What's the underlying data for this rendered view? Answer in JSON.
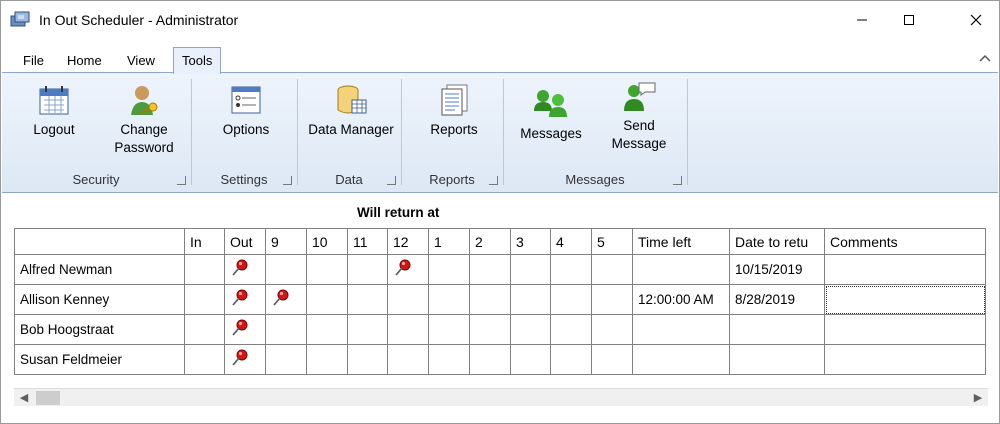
{
  "window": {
    "title": "In Out Scheduler - Administrator"
  },
  "tabs": [
    {
      "label": "File"
    },
    {
      "label": "Home"
    },
    {
      "label": "View"
    },
    {
      "label": "Tools"
    }
  ],
  "active_tab": "Tools",
  "ribbon": {
    "groups": [
      {
        "label": "Security",
        "buttons": [
          {
            "label": "Logout",
            "icon": "calendar-icon"
          },
          {
            "label1": "Change",
            "label2": "Password",
            "icon": "user-key-icon"
          }
        ]
      },
      {
        "label": "Settings",
        "buttons": [
          {
            "label": "Options",
            "icon": "options-form-icon"
          }
        ]
      },
      {
        "label": "Data",
        "buttons": [
          {
            "label": "Data Manager",
            "icon": "database-icon"
          }
        ]
      },
      {
        "label": "Reports",
        "buttons": [
          {
            "label": "Reports",
            "icon": "report-icon"
          }
        ]
      },
      {
        "label": "Messages",
        "buttons": [
          {
            "label": "Messages",
            "icon": "messages-icon"
          },
          {
            "label1": "Send",
            "label2": "Message",
            "icon": "send-message-icon"
          }
        ]
      }
    ]
  },
  "grid": {
    "title": "Will return at",
    "columns": [
      "",
      "In",
      "Out",
      "9",
      "10",
      "11",
      "12",
      "1",
      "2",
      "3",
      "4",
      "5",
      "Time left",
      "Date to retu",
      "Comments"
    ],
    "rows": [
      {
        "name": "Alfred Newman",
        "pins": [
          "Out",
          "12"
        ],
        "time_left": "",
        "date": "10/15/2019",
        "comments": ""
      },
      {
        "name": "Allison Kenney",
        "pins": [
          "Out",
          "9"
        ],
        "time_left": "12:00:00 AM",
        "date": "8/28/2019",
        "comments": ""
      },
      {
        "name": "Bob Hoogstraat",
        "pins": [
          "Out"
        ],
        "time_left": "",
        "date": "",
        "comments": ""
      },
      {
        "name": "Susan Feldmeier",
        "pins": [
          "Out"
        ],
        "time_left": "",
        "date": "",
        "comments": ""
      }
    ]
  },
  "colors": {
    "accent": "#8fa7c7",
    "ribbon": "#dde8f5",
    "pin": "#d01818"
  }
}
